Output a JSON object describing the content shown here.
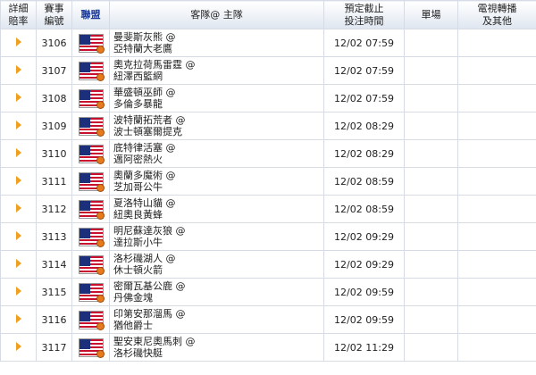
{
  "header": {
    "detail_odds": "詳細\n賠率",
    "event_no": "賽事\n編號",
    "league": "聯盟",
    "matchup": "客隊@ 主隊",
    "start_time": "預定截止\n投注時間",
    "single": "單場",
    "tv": "電視轉播\n及其他"
  },
  "accent_color": "#1a3a9c",
  "arrow_color": "#f0a020",
  "league_icon": "nba-flag-icon",
  "rows": [
    {
      "no": "3106",
      "away": "曼斐斯灰熊 @",
      "home": "亞特蘭大老鷹",
      "time": "12/02 07:59"
    },
    {
      "no": "3107",
      "away": "奧克拉荷馬雷霆 @",
      "home": "紐澤西籃網",
      "time": "12/02 07:59"
    },
    {
      "no": "3108",
      "away": "華盛頓巫師 @",
      "home": "多倫多暴龍",
      "time": "12/02 07:59"
    },
    {
      "no": "3109",
      "away": "波特蘭拓荒者 @",
      "home": "波士頓塞爾提克",
      "time": "12/02 08:29"
    },
    {
      "no": "3110",
      "away": "底特律活塞 @",
      "home": "邁阿密熱火",
      "time": "12/02 08:29"
    },
    {
      "no": "3111",
      "away": "奧蘭多魔術 @",
      "home": "芝加哥公牛",
      "time": "12/02 08:59"
    },
    {
      "no": "3112",
      "away": "夏洛特山貓 @",
      "home": "紐奧良黃蜂",
      "time": "12/02 08:59"
    },
    {
      "no": "3113",
      "away": "明尼蘇達灰狼 @",
      "home": "達拉斯小牛",
      "time": "12/02 09:29"
    },
    {
      "no": "3114",
      "away": "洛杉磯湖人 @",
      "home": "休士頓火箭",
      "time": "12/02 09:29"
    },
    {
      "no": "3115",
      "away": "密爾瓦基公鹿 @",
      "home": "丹佛金塊",
      "time": "12/02 09:59"
    },
    {
      "no": "3116",
      "away": "印第安那溜馬 @",
      "home": "猶他爵士",
      "time": "12/02 09:59"
    },
    {
      "no": "3117",
      "away": "聖安東尼奧馬刺 @",
      "home": "洛杉磯快艇",
      "time": "12/02 11:29"
    }
  ]
}
